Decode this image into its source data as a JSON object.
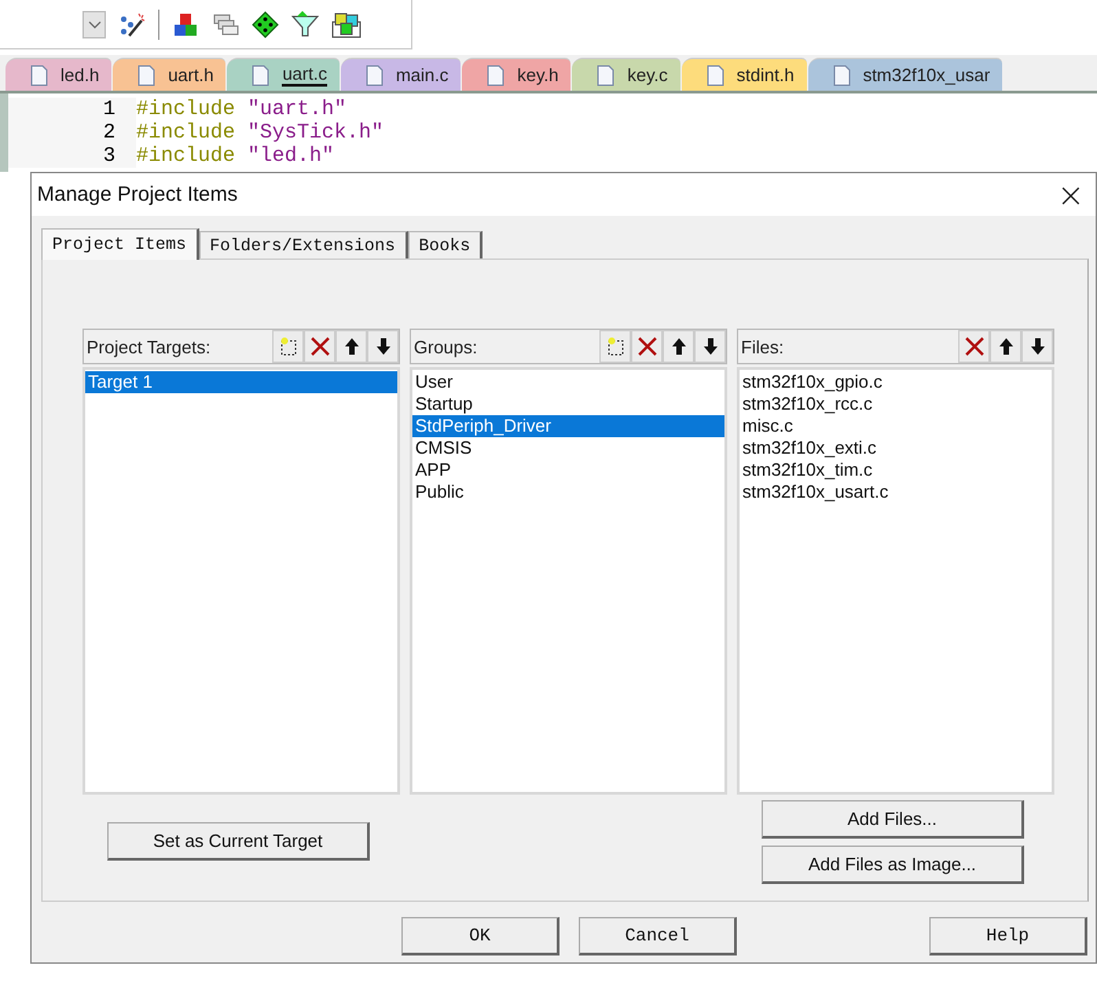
{
  "editor": {
    "file_tabs": [
      {
        "label": "led.h",
        "color": "#e6b8cb",
        "selected": false
      },
      {
        "label": "uart.h",
        "color": "#f8c293",
        "selected": false
      },
      {
        "label": "uart.c",
        "color": "#a9d2c3",
        "selected": true
      },
      {
        "label": "main.c",
        "color": "#c8b8e6",
        "selected": false
      },
      {
        "label": "key.h",
        "color": "#efa5a5",
        "selected": false
      },
      {
        "label": "key.c",
        "color": "#c8d8ab",
        "selected": false
      },
      {
        "label": "stdint.h",
        "color": "#fddc7c",
        "selected": false
      },
      {
        "label": "stm32f10x_usar",
        "color": "#abc4dc",
        "selected": false
      }
    ],
    "lines": [
      {
        "number": "1",
        "directive": "#include",
        "argument": "\"uart.h\""
      },
      {
        "number": "2",
        "directive": "#include",
        "argument": "\"SysTick.h\""
      },
      {
        "number": "3",
        "directive": "#include",
        "argument": "\"led.h\""
      }
    ]
  },
  "dialog": {
    "title": "Manage Project Items",
    "close": "×",
    "tabs": [
      {
        "label": "Project Items",
        "selected": true
      },
      {
        "label": "Folders/Extensions",
        "selected": false
      },
      {
        "label": "Books",
        "selected": false
      }
    ],
    "panes": [
      {
        "label": "Project Targets:",
        "can_add": true,
        "items": [
          {
            "label": "Target 1",
            "selected": true
          }
        ]
      },
      {
        "label": "Groups:",
        "can_add": true,
        "items": [
          {
            "label": "User",
            "selected": false
          },
          {
            "label": "Startup",
            "selected": false
          },
          {
            "label": "StdPeriph_Driver",
            "selected": true
          },
          {
            "label": "CMSIS",
            "selected": false
          },
          {
            "label": "APP",
            "selected": false
          },
          {
            "label": "Public",
            "selected": false
          }
        ]
      },
      {
        "label": "Files:",
        "can_add": false,
        "items": [
          {
            "label": "stm32f10x_gpio.c",
            "selected": false
          },
          {
            "label": "stm32f10x_rcc.c",
            "selected": false
          },
          {
            "label": "misc.c",
            "selected": false
          },
          {
            "label": "stm32f10x_exti.c",
            "selected": false
          },
          {
            "label": "stm32f10x_tim.c",
            "selected": false
          },
          {
            "label": "stm32f10x_usart.c",
            "selected": false
          }
        ]
      }
    ],
    "target_button": "Set as Current Target",
    "file_buttons": [
      "Add Files...",
      "Add Files as Image..."
    ],
    "buttons": [
      "OK",
      "Cancel",
      "Help"
    ]
  }
}
